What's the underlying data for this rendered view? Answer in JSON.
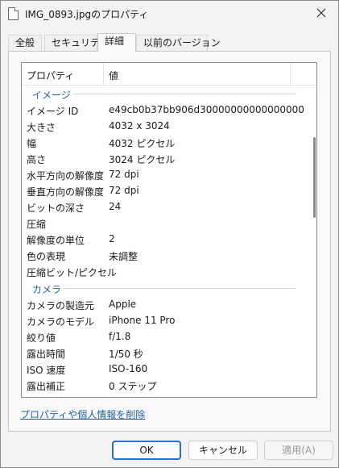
{
  "window": {
    "title": "IMG_0893.jpgのプロパティ",
    "icon": "document-icon"
  },
  "tabs": [
    {
      "label": "全般"
    },
    {
      "label": "セキュリティ"
    },
    {
      "label": "詳細",
      "active": true
    },
    {
      "label": "以前のバージョン"
    }
  ],
  "list": {
    "header_property": "プロパティ",
    "header_value": "値",
    "groups": [
      {
        "name": "イメージ",
        "rows": [
          {
            "key": "イメージ ID",
            "value": "e49cb0b37bb906d30000000000000000"
          },
          {
            "key": "大きさ",
            "value": "4032 x 3024"
          },
          {
            "key": "幅",
            "value": "4032 ピクセル"
          },
          {
            "key": "高さ",
            "value": "3024 ピクセル"
          },
          {
            "key": "水平方向の解像度",
            "value": "72 dpi"
          },
          {
            "key": "垂直方向の解像度",
            "value": "72 dpi"
          },
          {
            "key": "ビットの深さ",
            "value": "24"
          },
          {
            "key": "圧縮",
            "value": ""
          },
          {
            "key": "解像度の単位",
            "value": "2"
          },
          {
            "key": "色の表現",
            "value": "未調整"
          },
          {
            "key": "圧縮ビット/ピクセル",
            "value": ""
          }
        ]
      },
      {
        "name": "カメラ",
        "rows": [
          {
            "key": "カメラの製造元",
            "value": "Apple"
          },
          {
            "key": "カメラのモデル",
            "value": "iPhone 11 Pro"
          },
          {
            "key": "絞り値",
            "value": "f/1.8"
          },
          {
            "key": "露出時間",
            "value": "1/50 秒"
          },
          {
            "key": "ISO 速度",
            "value": "ISO-160"
          },
          {
            "key": "露出補正",
            "value": "0 ステップ"
          }
        ]
      }
    ]
  },
  "remove_link": "プロパティや個人情報を削除",
  "buttons": {
    "ok": "OK",
    "cancel": "キャンセル",
    "apply": "適用(A)"
  },
  "colors": {
    "accent": "#2b6dd0",
    "group_header": "#1f5fb0"
  }
}
